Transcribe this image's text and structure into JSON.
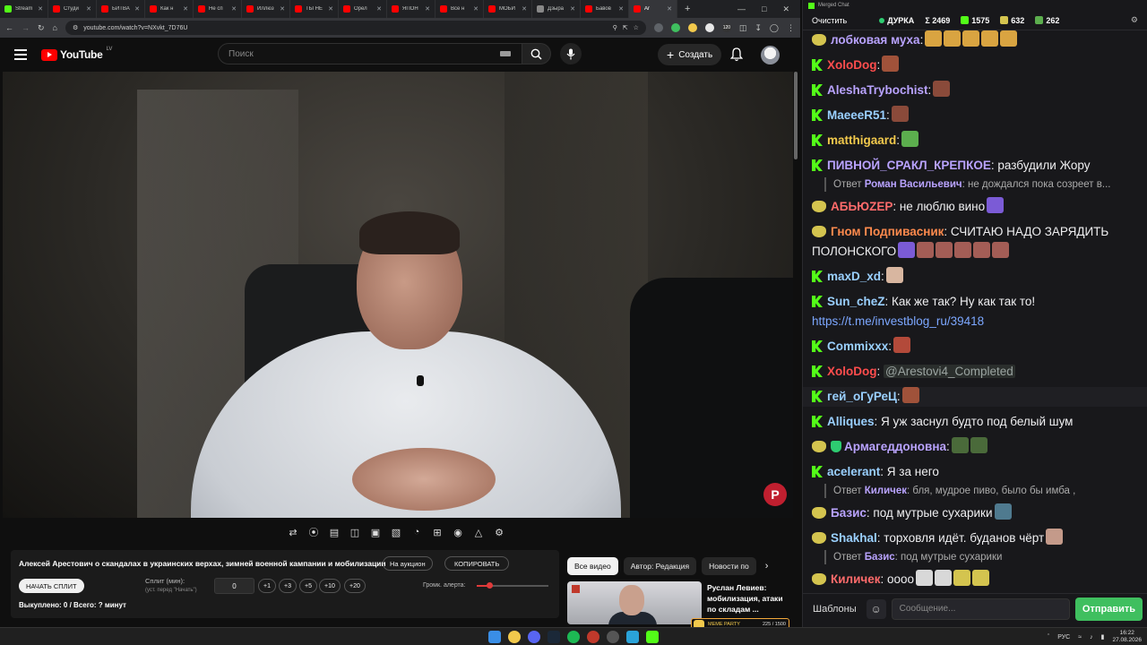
{
  "browser": {
    "tabs": [
      {
        "label": "Stream",
        "color": "#53fc18"
      },
      {
        "label": "Студи",
        "color": "#ff0000"
      },
      {
        "label": "БИТВА",
        "color": "#ff0000"
      },
      {
        "label": "Как н",
        "color": "#ff0000"
      },
      {
        "label": "Не сп",
        "color": "#ff0000"
      },
      {
        "label": "Иллюз",
        "color": "#ff0000"
      },
      {
        "label": "ТЫ НЕ",
        "color": "#ff0000"
      },
      {
        "label": "Орел",
        "color": "#ff0000"
      },
      {
        "label": "ЯПОН",
        "color": "#ff0000"
      },
      {
        "label": "Все н",
        "color": "#ff0000"
      },
      {
        "label": "МОБИ",
        "color": "#ff0000"
      },
      {
        "label": "Дзыра",
        "color": "#888888"
      },
      {
        "label": "Бавов",
        "color": "#ff0000"
      },
      {
        "label": "Ar",
        "color": "#ff0000"
      }
    ],
    "new_tab": "+",
    "url": "youtube.com/watch?v=NXvkt_7D76U",
    "ext_badge": "120"
  },
  "youtube": {
    "logo_text": "YouTube",
    "region": "LV",
    "search_placeholder": "Поиск",
    "create_label": "Создать"
  },
  "auction": {
    "video_title": "Алексей Арестович о скандалах в украинских верхах, зимней военной кампании и мобилизации",
    "auction_btn": "На аукцион",
    "copy_btn": "КОПИРОВАТЬ",
    "split_btn": "НАЧАТЬ СПЛИТ",
    "split_label": "Сплит (мин):",
    "split_hint": "(уст. перед \"Начать\")",
    "split_value": "0",
    "increments": [
      "+1",
      "+3",
      "+5",
      "+10",
      "+20"
    ],
    "volume_label": "Громк. алерта:",
    "volume_level": 0.18,
    "bought": "Выкуплено: 0 / Всего: ? минут"
  },
  "chips": [
    "Все видео",
    "Автор: Редакция",
    "Новости по"
  ],
  "recommended": {
    "title": "Руслан Левиев: мобилизация, атаки по складам ..."
  },
  "meme_party": {
    "label": "MEME PARTY",
    "count": "225 / 1500"
  },
  "chat": {
    "window_title": "Merged Chat",
    "clear_btn": "Очистить",
    "stream_name": "ДУРКА",
    "stats": [
      {
        "icon": "sigma",
        "value": "Σ 2469"
      },
      {
        "icon": "kick-icon",
        "value": "1575"
      },
      {
        "icon": "glasses-icon",
        "value": "632"
      },
      {
        "icon": "leaf-icon",
        "value": "262"
      }
    ],
    "messages": [
      {
        "badge": "glasses",
        "user": "лобковая муха",
        "color": "#b9a3ff",
        "text": ":",
        "emotes": [
          "#d9a441",
          "#d9a441",
          "#d9a441",
          "#d9a441",
          "#d9a441"
        ]
      },
      {
        "badge": "kick",
        "user": "XoloDog",
        "color": "#ff4d4d",
        "text": ":",
        "emotes": [
          "#a0523a"
        ]
      },
      {
        "badge": "kick",
        "user": "AleshaTrybochist",
        "color": "#b9a3ff",
        "text": ":",
        "emotes": [
          "#8a4a3a"
        ]
      },
      {
        "badge": "kick",
        "user": "MaeeeR51",
        "color": "#9ad0ff",
        "text": ":",
        "emotes": [
          "#8a4a3a"
        ]
      },
      {
        "badge": "kick",
        "user": "matthigaard",
        "color": "#f2c94c",
        "text": ":",
        "emotes": [
          "#5cae4e"
        ]
      },
      {
        "badge": "kick",
        "user": "ПИВНОЙ_СРАКЛ_КРЕПКОЕ",
        "color": "#b9a3ff",
        "text": ": разбудили Жору",
        "emotes": [],
        "reply": {
          "prefix": "Ответ",
          "user": "Роман Васильевич",
          "text": ": не дождался пока созреет в..."
        }
      },
      {
        "badge": "glasses",
        "user": "АБЬЮZEP",
        "color": "#ff6b6b",
        "text": ": не люблю вино",
        "emotes": [
          "#7b5bd6"
        ]
      },
      {
        "badge": "glasses",
        "user": "Гном Подпивасник",
        "color": "#ff8a4d",
        "text": ": СЧИТАЮ НАДО ЗАРЯДИТЬ ПОЛОНСКОГО",
        "emotes": [
          "#7b5bd6",
          "#a35d56",
          "#a35d56",
          "#a35d56",
          "#a35d56",
          "#a35d56"
        ]
      },
      {
        "badge": "kick",
        "user": "maxD_xd",
        "color": "#9ad0ff",
        "text": ":",
        "emotes": [
          "#d8b6a0"
        ]
      },
      {
        "badge": "kick",
        "user": "Sun_cheZ",
        "color": "#9ad0ff",
        "text": ": Как же так? Ну как так то!",
        "link": "https://t.me/investblog_ru/39418",
        "emotes": []
      },
      {
        "badge": "kick",
        "user": "Commixxx",
        "color": "#9ad0ff",
        "text": ":",
        "emotes": [
          "#b34a3a"
        ]
      },
      {
        "badge": "kick",
        "user": "XoloDog",
        "color": "#ff4d4d",
        "text": ":",
        "mention": "@Arestovi4_Completed",
        "emotes": []
      },
      {
        "badge": "kick",
        "user": "гей_оГуРеЦ",
        "color": "#9ad0ff",
        "text": ":",
        "emotes": [
          "#a0523a"
        ],
        "highlight": true
      },
      {
        "badge": "kick",
        "user": "Alliques",
        "color": "#9ad0ff",
        "text": ": Я уж заснул будто под белый шум",
        "emotes": []
      },
      {
        "badge": "glasses-shield",
        "user": "Армагеддоновна",
        "color": "#b9a3ff",
        "text": ":",
        "emotes": [
          "#4a6a3a",
          "#4a6a3a"
        ]
      },
      {
        "badge": "kick",
        "user": "acelerant",
        "color": "#9ad0ff",
        "text": ": Я за него",
        "emotes": [],
        "reply": {
          "prefix": "Ответ",
          "user": "Киличек",
          "text": ": бля, мудрое пиво, было бы имба ,"
        }
      },
      {
        "badge": "glasses",
        "user": "Базис",
        "color": "#b9a3ff",
        "text": ": под мутрые сухарики",
        "emotes": [
          "#4f7a8f"
        ]
      },
      {
        "badge": "glasses",
        "user": "Shakhal",
        "color": "#9ad0ff",
        "text": ": торховля идёт. буданов чёрт",
        "emotes": [
          "#c49a8a"
        ],
        "reply": {
          "prefix": "Ответ",
          "user": "Базис",
          "text": ": под мутрые сухарики"
        }
      },
      {
        "badge": "glasses",
        "user": "Киличек",
        "color": "#ff6b6b",
        "text": ": оооо",
        "emotes": [
          "#d8d8d8",
          "#d8d8d8",
          "#d4c44f",
          "#d4c44f"
        ]
      }
    ],
    "templates_btn": "Шаблоны",
    "message_placeholder": "Сообщение...",
    "send_btn": "Отправить"
  },
  "taskbar": {
    "lang": "РУС",
    "time": "16:22",
    "date": "27.08.2026"
  }
}
